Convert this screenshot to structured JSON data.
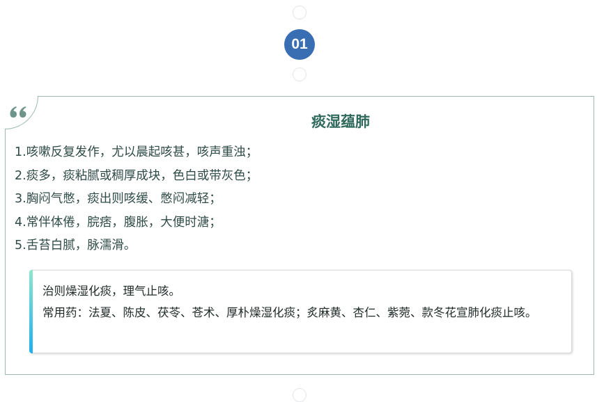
{
  "section": {
    "number": "01",
    "title": "痰湿蕴肺"
  },
  "symptoms": [
    "1.咳嗽反复发作，尤以晨起咳甚，咳声重浊；",
    "2.痰多，痰粘腻或稠厚成块，色白或带灰色；",
    "3.胸闷气憋，痰出则咳缓、憋闷减轻；",
    "4.常伴体倦，脘痞，腹胀，大便时溏；",
    "5.舌苔白腻，脉濡滑。"
  ],
  "treatment": {
    "principle": "治则燥湿化痰，理气止咳。",
    "medicines": "常用药：法夏、陈皮、茯苓、苍术、厚朴燥湿化痰；炙麻黄、杏仁、紫菀、款冬花宣肺化痰止咳。"
  },
  "colors": {
    "badge": "#3a6eb3",
    "title": "#2f6a5c",
    "card_border": "#9eb9b1",
    "accent_top": "#8fe6cc",
    "accent_bottom": "#20aef0"
  },
  "icons": {
    "quote": "quote-icon",
    "timeline_node": "circle-ring-icon"
  }
}
